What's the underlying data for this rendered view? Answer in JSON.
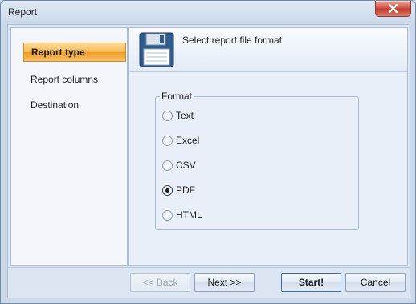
{
  "window": {
    "title": "Report"
  },
  "sidebar": {
    "items": [
      {
        "label": "Report type",
        "active": true
      },
      {
        "label": "Report columns",
        "active": false
      },
      {
        "label": "Destination",
        "active": false
      }
    ]
  },
  "header": {
    "text": "Select report file format",
    "icon": "floppy-disk-icon"
  },
  "format_group": {
    "legend": "Format",
    "options": [
      {
        "label": "Text",
        "checked": false
      },
      {
        "label": "Excel",
        "checked": false
      },
      {
        "label": "CSV",
        "checked": false
      },
      {
        "label": "PDF",
        "checked": true
      },
      {
        "label": "HTML",
        "checked": false
      }
    ]
  },
  "buttons": {
    "back": "<< Back",
    "next": "Next >>",
    "start": "Start!",
    "cancel": "Cancel"
  },
  "colors": {
    "active_item": "#f7b74e",
    "close_button": "#c13d2f"
  }
}
